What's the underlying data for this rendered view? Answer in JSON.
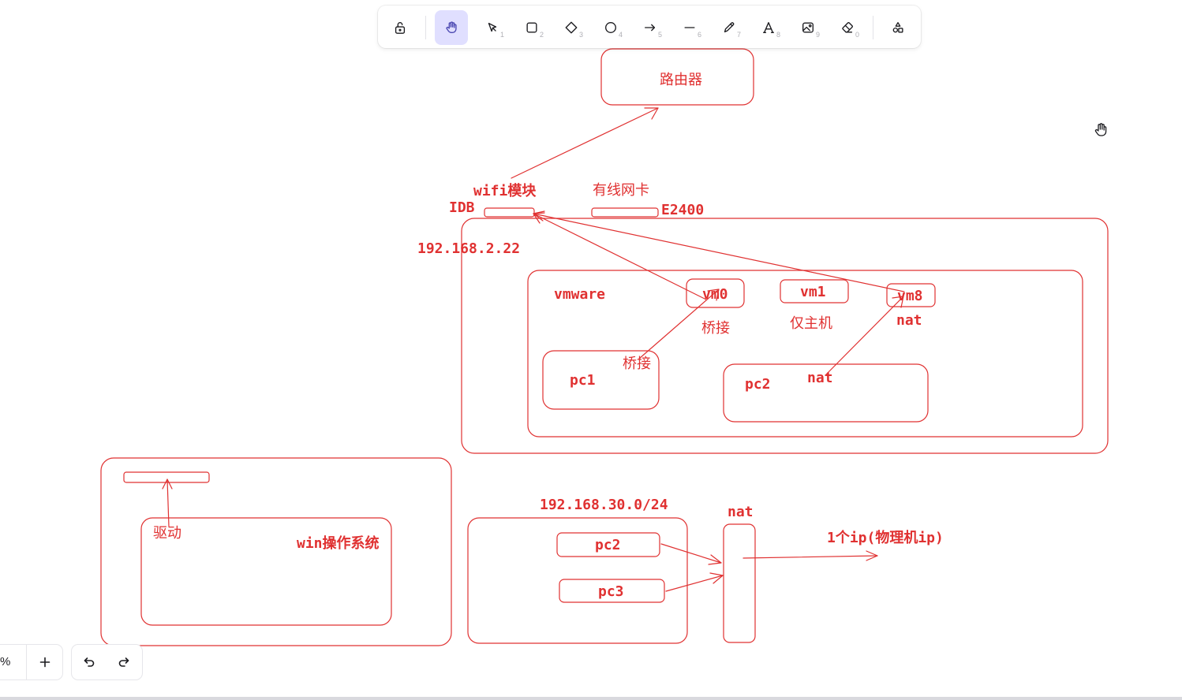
{
  "toolbar": {
    "tools": [
      {
        "name": "lock",
        "key": ""
      },
      {
        "name": "hand",
        "key": ""
      },
      {
        "name": "selection",
        "key": "1"
      },
      {
        "name": "rectangle",
        "key": "2"
      },
      {
        "name": "diamond",
        "key": "3"
      },
      {
        "name": "ellipse",
        "key": "4"
      },
      {
        "name": "arrow",
        "key": "5"
      },
      {
        "name": "line",
        "key": "6"
      },
      {
        "name": "draw",
        "key": "7"
      },
      {
        "name": "text",
        "key": "8"
      },
      {
        "name": "image",
        "key": "9"
      },
      {
        "name": "eraser",
        "key": "0"
      },
      {
        "name": "extra-tools",
        "key": ""
      }
    ],
    "active_tool": "hand"
  },
  "canvas": {
    "stroke_color": "#e03131",
    "labels": {
      "router": "路由器",
      "wifi_module": "wifi模块",
      "wired_nic": "有线网卡",
      "idb": "IDB",
      "e2400": "E2400",
      "host_ip": "192.168.2.22",
      "vmware": "vmware",
      "vm0": "vm0",
      "vm1": "vm1",
      "vm8": "vm8",
      "bridge_label": "桥接",
      "host_only_label": "仅主机",
      "nat_label": "nat",
      "pc1": "pc1",
      "pc1_bridge": "桥接",
      "pc2": "pc2",
      "pc2_nat": "nat",
      "driver": "驱动",
      "win_os": "win操作系统",
      "subnet": "192.168.30.0/24",
      "nat_box_label": "nat",
      "lower_pc2": "pc2",
      "lower_pc3": "pc3",
      "one_ip": "1个ip(物理机ip)"
    }
  },
  "footer": {
    "zoom_value": "%",
    "zoom_in": "+"
  }
}
